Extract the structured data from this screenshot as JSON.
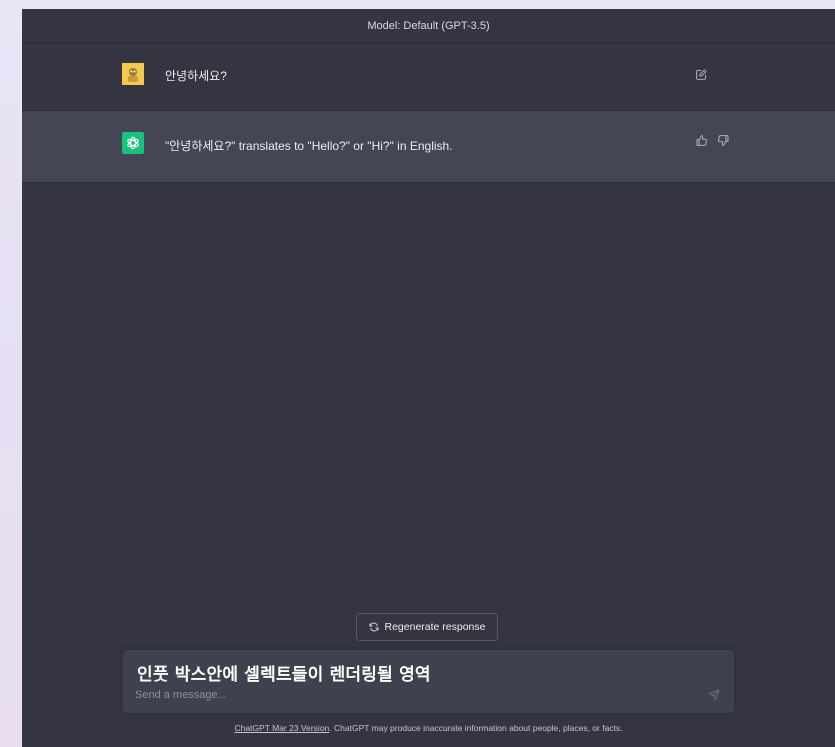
{
  "header": {
    "model_label": "Model: Default (GPT-3.5)"
  },
  "conversation": {
    "user_message": "안녕하세요?",
    "assistant_message": "\"안녕하세요?\" translates to \"Hello?\" or \"Hi?\" in English."
  },
  "icons": {
    "user_avatar": "user-avatar-icon",
    "assistant_avatar": "openai-logo-icon",
    "edit": "edit-icon",
    "thumbs_up": "thumbs-up-icon",
    "thumbs_down": "thumbs-down-icon",
    "regenerate": "refresh-icon",
    "send": "send-icon"
  },
  "colors": {
    "background": "#343541",
    "assistant_row": "#444654",
    "input_bg": "#40414f",
    "assistant_avatar": "#19c37d",
    "user_avatar": "#f2c94c"
  },
  "composer": {
    "regenerate_label": "Regenerate response",
    "overlay_text": "인풋 박스안에 셀렉트들이 렌더링될 영역",
    "placeholder": "Send a message..."
  },
  "footer": {
    "version_link": "ChatGPT Mar 23 Version",
    "disclaimer": ". ChatGPT may produce inaccurate information about people, places, or facts."
  }
}
